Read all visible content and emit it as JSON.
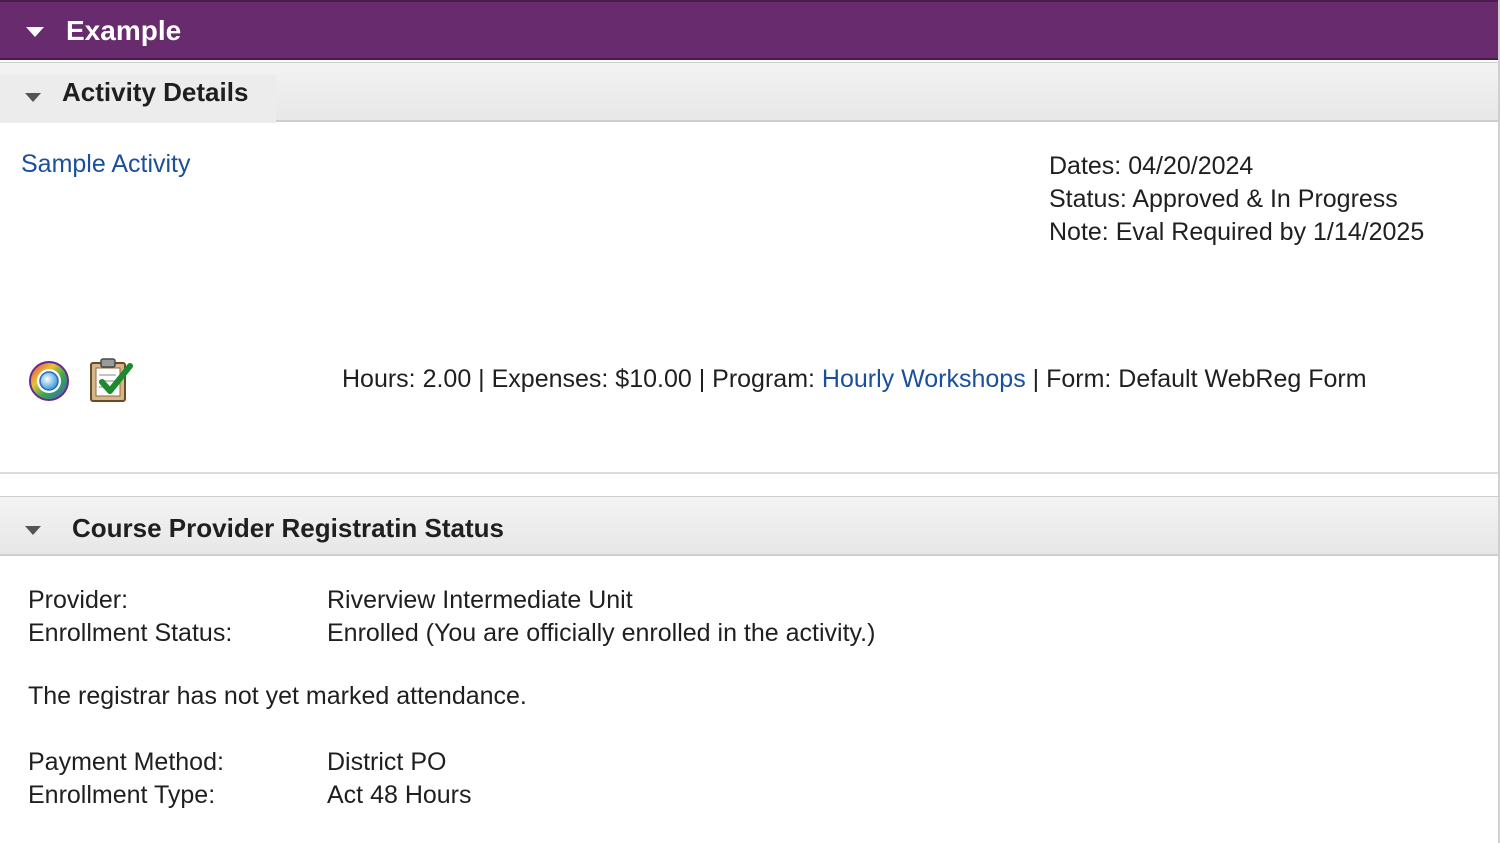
{
  "header": {
    "title": "Example"
  },
  "activity_details": {
    "section_title": "Activity Details",
    "activity_name": "Sample Activity",
    "dates": "Dates: 04/20/2024",
    "status": "Status: Approved & In Progress",
    "note": "Note: Eval Required by 1/14/2025",
    "summary": {
      "hours": "Hours: 2.00 | Expenses: $10.00 | Program: ",
      "program_link": "Hourly Workshops",
      "form": " | Form: Default WebReg Form"
    },
    "icons": [
      "globe-icon",
      "clipboard-check-icon"
    ]
  },
  "registration": {
    "section_title": "Course Provider Registratin Status",
    "provider_label": "Provider:",
    "provider_value": "Riverview Intermediate Unit",
    "enrollment_status_label": "Enrollment Status:",
    "enrollment_status_value": "Enrolled (You are officially enrolled in the activity.)",
    "attendance_note": "The registrar has not yet marked attendance.",
    "payment_method_label": "Payment Method:",
    "payment_method_value": "District PO",
    "enrollment_type_label": "Enrollment Type:",
    "enrollment_type_value": "Act 48 Hours"
  },
  "colors": {
    "header_bg": "#682b6d",
    "link": "#1a4f9c"
  }
}
